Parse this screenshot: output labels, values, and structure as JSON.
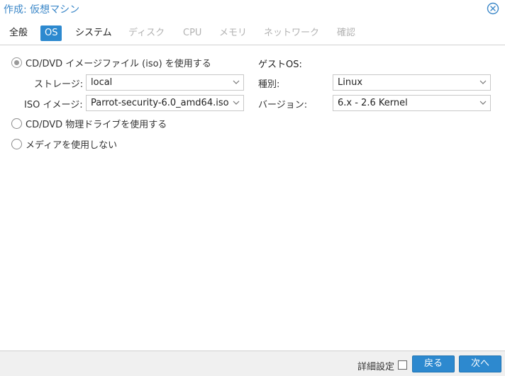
{
  "window": {
    "title": "作成: 仮想マシン",
    "close_icon": "close-circle-icon",
    "accent_color": "#2d89cf"
  },
  "tabs": [
    {
      "label": "全般",
      "state": "normal"
    },
    {
      "label": "OS",
      "state": "active"
    },
    {
      "label": "システム",
      "state": "normal"
    },
    {
      "label": "ディスク",
      "state": "disabled"
    },
    {
      "label": "CPU",
      "state": "disabled"
    },
    {
      "label": "メモリ",
      "state": "disabled"
    },
    {
      "label": "ネットワーク",
      "state": "disabled"
    },
    {
      "label": "確認",
      "state": "disabled"
    }
  ],
  "media": {
    "iso_option": {
      "label": "CD/DVD イメージファイル (iso) を使用する",
      "checked": true
    },
    "storage": {
      "label": "ストレージ:",
      "value": "local"
    },
    "iso_image": {
      "label": "ISO イメージ:",
      "value": "Parrot-security-6.0_amd64.iso"
    },
    "physical_option": {
      "label": "CD/DVD 物理ドライブを使用する",
      "checked": false
    },
    "none_option": {
      "label": "メディアを使用しない",
      "checked": false
    }
  },
  "guest_os": {
    "heading": "ゲストOS:",
    "type": {
      "label": "種別:",
      "value": "Linux"
    },
    "version": {
      "label": "バージョン:",
      "value": "6.x - 2.6 Kernel"
    }
  },
  "footer": {
    "advanced_label": "詳細設定",
    "advanced_checked": false,
    "back_label": "戻る",
    "next_label": "次へ"
  }
}
